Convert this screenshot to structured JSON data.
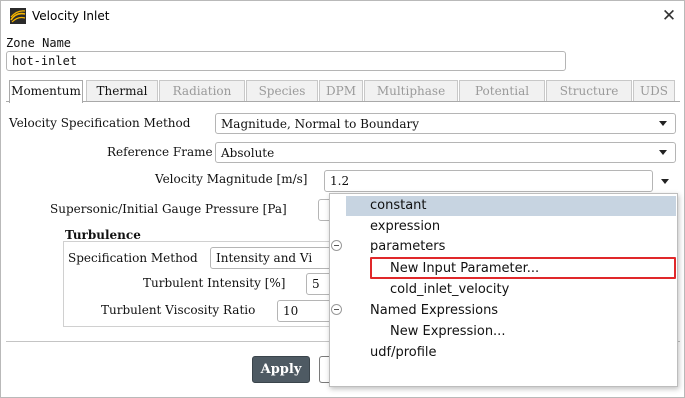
{
  "window": {
    "title": "Velocity Inlet"
  },
  "zone": {
    "label": "Zone Name",
    "value": "hot-inlet"
  },
  "tabs": [
    {
      "label": "Momentum",
      "state": "active"
    },
    {
      "label": "Thermal",
      "state": "enabled"
    },
    {
      "label": "Radiation",
      "state": "disabled"
    },
    {
      "label": "Species",
      "state": "disabled"
    },
    {
      "label": "DPM",
      "state": "disabled"
    },
    {
      "label": "Multiphase",
      "state": "disabled"
    },
    {
      "label": "Potential",
      "state": "disabled"
    },
    {
      "label": "Structure",
      "state": "disabled"
    },
    {
      "label": "UDS",
      "state": "disabled"
    }
  ],
  "momentum": {
    "velocity_spec_label": "Velocity Specification Method",
    "velocity_spec_value": "Magnitude, Normal to Boundary",
    "reference_frame_label": "Reference Frame",
    "reference_frame_value": "Absolute",
    "velocity_magnitude_label": "Velocity Magnitude [m/s]",
    "velocity_magnitude_value": "1.2",
    "gauge_pressure_label": "Supersonic/Initial Gauge Pressure [Pa]"
  },
  "turbulence": {
    "heading": "Turbulence",
    "spec_method_label": "Specification Method",
    "spec_method_value": "Intensity and Vi",
    "intensity_label": "Turbulent Intensity [%]",
    "intensity_value": "5",
    "viscosity_ratio_label": "Turbulent Viscosity Ratio",
    "viscosity_ratio_value": "10"
  },
  "buttons": {
    "apply": "Apply"
  },
  "menu": {
    "items": [
      {
        "label": "constant",
        "selected": true
      },
      {
        "label": "expression"
      },
      {
        "label": "parameters"
      },
      {
        "label": "New Input Parameter..."
      },
      {
        "label": "cold_inlet_velocity"
      },
      {
        "label": "Named Expressions"
      },
      {
        "label": "New Expression..."
      },
      {
        "label": "udf/profile"
      }
    ]
  },
  "colors": {
    "highlight": "#e0282a",
    "apply_bg": "#4e5a63",
    "menu_selected": "#c7d4e1"
  }
}
